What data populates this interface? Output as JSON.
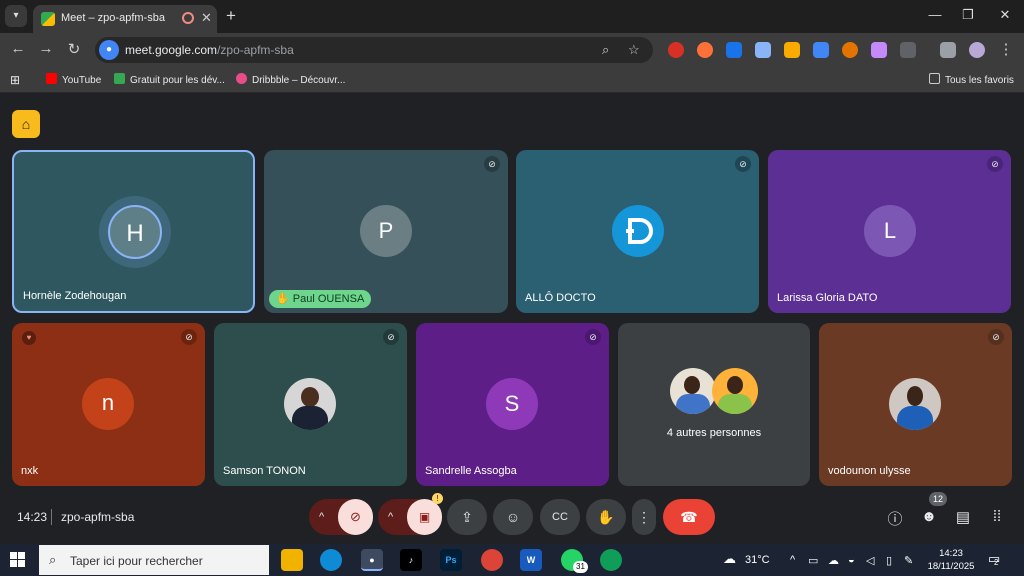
{
  "browser": {
    "tab_title": "Meet – zpo-apfm-sba",
    "url_host": "meet.google.com",
    "url_path": "/zpo-apfm-sba",
    "bookmarks": [
      "YouTube",
      "Gratuit pour les dév...",
      "Dribbble – Découvr..."
    ],
    "all_bookmarks": "Tous les favoris"
  },
  "meet": {
    "tiles_row1": [
      {
        "name": "Hornèle Zodehougan",
        "initial": "H",
        "bg": "#2f5760",
        "avatar_bg": "#5f7f88"
      },
      {
        "name": "Paul OUENSA",
        "initial": "P",
        "bg": "#355058",
        "avatar_bg": "#6a7e84"
      },
      {
        "name": "ALLÔ DOCTO",
        "initial": "",
        "bg": "#2b5f72",
        "avatar_bg": "#1596d8"
      },
      {
        "name": "Larissa Gloria DATO",
        "initial": "L",
        "bg": "#5c2f94",
        "avatar_bg": "#7d57b4"
      }
    ],
    "tiles_row2": [
      {
        "name": "nxk",
        "initial": "n",
        "bg": "#8c2f14",
        "avatar_bg": "#c4421a"
      },
      {
        "name": "Samson TONON",
        "initial": "",
        "bg": "#2d4e4c",
        "avatar_bg": "#6b6b6b"
      },
      {
        "name": "Sandrelle Assogba",
        "initial": "S",
        "bg": "#5d1f87",
        "avatar_bg": "#8e3ab8"
      },
      {
        "name": "4 autres personnes",
        "initial": "",
        "bg": "#3c4043",
        "avatar_bg": "#6b6b6b"
      },
      {
        "name": "vodounon ulysse",
        "initial": "",
        "bg": "#6b3a24",
        "avatar_bg": "#8a6a55"
      }
    ],
    "time": "14:23",
    "meeting_code": "zpo-apfm-sba",
    "participants_count": "12"
  },
  "taskbar": {
    "search_placeholder": "Taper ici pour rechercher",
    "weather": "31°C",
    "clock_time": "14:23",
    "clock_date": "18/11/2025",
    "notifications": "2",
    "whatsapp_badge": "31"
  }
}
